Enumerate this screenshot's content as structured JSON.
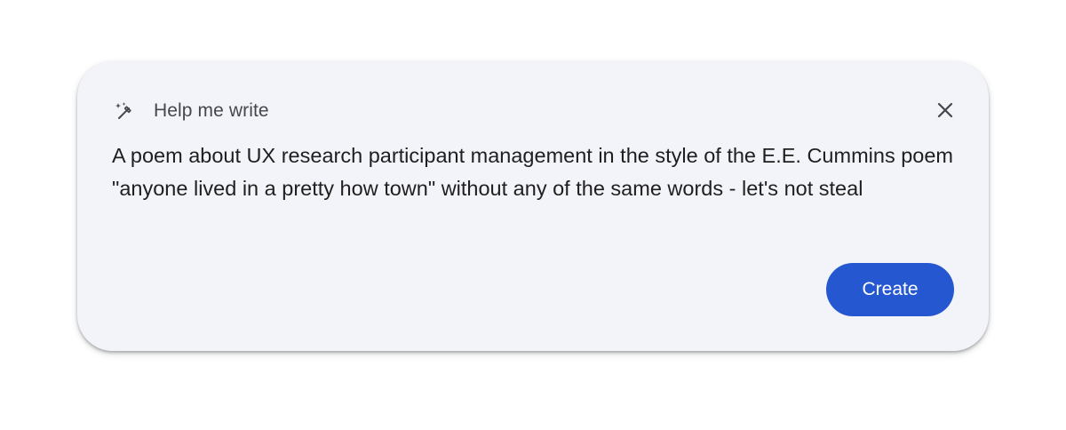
{
  "dialog": {
    "title": "Help me write",
    "title_icon": "magic-pen-icon",
    "close_icon": "close-icon",
    "prompt_text": "A poem about UX research participant management in the style of the E.E. Cummins poem \"anyone lived in a pretty how town\" without any of the same words - let's not steal",
    "create_label": "Create"
  },
  "colors": {
    "dialog_background": "#f3f4f9",
    "accent": "#2557d0",
    "text_primary": "#1f1f1f",
    "text_secondary": "#44474e"
  }
}
